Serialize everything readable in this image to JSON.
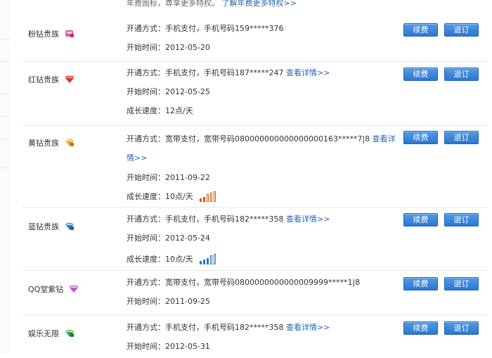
{
  "top": {
    "text": "年费图标，尊享更多特权。",
    "link": "了解年费更多特权>>"
  },
  "buttons": {
    "renew": "续费",
    "cancel": "退订"
  },
  "rows": [
    {
      "name": "粉钻贵族",
      "gem_icon": "pink-diamond-icon",
      "gem_color": "#e55a9a",
      "method": "开通方式：手机支付，手机号码159*****376",
      "start": "开始时间：2012-05-20"
    },
    {
      "name": "红钻贵族",
      "gem_icon": "red-diamond-icon",
      "gem_color": "#d8332a",
      "method": "开通方式：手机支付，手机号码187*****247",
      "link": "查看详情>>",
      "start": "开始时间：2012-05-25",
      "speed": "成长速度：12点/天"
    },
    {
      "name": "黄钻贵族",
      "gem_icon": "yellow-diamond-icon",
      "gem_color": "#e9a61b",
      "method": "开通方式：宽带支付，宽带号码080000000000000000163*****7|8",
      "link": "查看详情>>",
      "start": "开始时间：2011-09-22",
      "speed": "成长速度：10点/天",
      "speed_level": 2,
      "speed_max": 5,
      "bar_color": "#cf5b12"
    },
    {
      "name": "蓝钻贵族",
      "gem_icon": "blue-diamond-icon",
      "gem_color": "#2f86d6",
      "method": "开通方式：手机支付，手机号码182*****358",
      "link": "查看详情>>",
      "start": "开始时间：2012-05-24",
      "speed": "成长速度：10点/天",
      "speed_level": 3,
      "speed_max": 5,
      "bar_color": "#2878cc"
    },
    {
      "name": "QQ堂紫钻",
      "gem_icon": "purple-diamond-icon",
      "gem_color": "#c155cf",
      "method": "开通方式：宽带支付，宽带号码0800000000000009999*****1|8",
      "start": "开始时间：2011-09-25"
    },
    {
      "name": "娱乐无限",
      "gem_icon": "green-diamond-icon",
      "gem_color": "#3aa64a",
      "method": "开通方式：手机支付，手机号码182*****358",
      "link": "查看详情>>",
      "start": "开始时间：2012-05-31"
    }
  ]
}
